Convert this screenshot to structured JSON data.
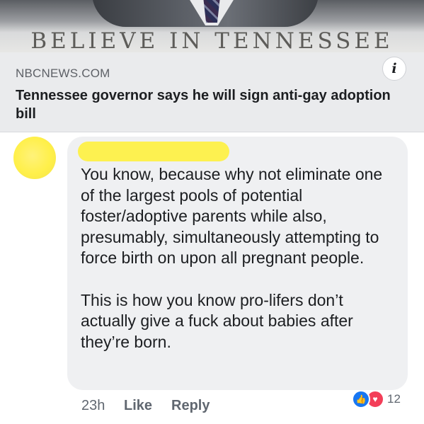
{
  "preview": {
    "banner_text": "BELIEVE IN TENNESSEE"
  },
  "link_card": {
    "source": "NBCNEWS.COM",
    "headline": "Tennessee governor says he will sign anti-gay adoption bill",
    "info_icon": "info-icon",
    "info_glyph": "i"
  },
  "comment": {
    "author_redacted": true,
    "redaction_color": "#fdf150",
    "paragraphs": [
      "You know, because why not eliminate one of the largest pools of potential foster/adoptive parents while also, presumably, simultaneously attempting to force birth on upon all pregnant people.",
      "This is how you know pro-lifers don’t actually give a fuck about babies after they’re born."
    ],
    "timestamp": "23h",
    "like_label": "Like",
    "reply_label": "Reply",
    "reactions": {
      "icons": [
        "like-reaction-icon",
        "love-reaction-icon"
      ],
      "like_glyph": "👍",
      "love_glyph": "♥",
      "count": "12"
    }
  }
}
